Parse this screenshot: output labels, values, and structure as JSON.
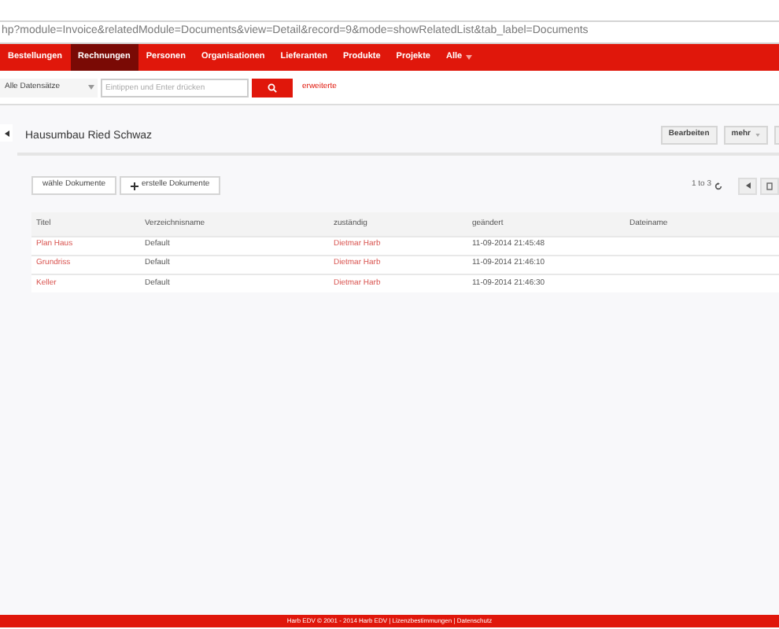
{
  "address_bar": {
    "url": "hp?module=Invoice&relatedModule=Documents&view=Detail&record=9&mode=showRelatedList&tab_label=Documents"
  },
  "nav": [
    {
      "label": "Bestellungen",
      "selected": false
    },
    {
      "label": "Rechnungen",
      "selected": true
    },
    {
      "label": "Personen",
      "selected": false
    },
    {
      "label": "Organisationen",
      "selected": false
    },
    {
      "label": "Lieferanten",
      "selected": false
    },
    {
      "label": "Produkte",
      "selected": false
    },
    {
      "label": "Projekte",
      "selected": false
    },
    {
      "label": "Alle",
      "selected": false,
      "dropdown": true
    }
  ],
  "search": {
    "filter": "Alle Datensätze",
    "placeholder": "Eintippen und Enter drücken",
    "advanced_link": "erweiterte"
  },
  "record": {
    "title": "Hausumbau Ried Schwaz",
    "actions": [
      "Bearbeiten",
      "mehr"
    ]
  },
  "related": {
    "buttons": [
      {
        "label": "wähle Dokumente",
        "kind": "plain"
      },
      {
        "label": "erstelle Dokumente",
        "kind": "add"
      }
    ],
    "pagination": "1 to 3",
    "columns": [
      "Titel",
      "Verzeichnisname",
      "zuständig",
      "geändert",
      "Dateiname"
    ],
    "rows": [
      [
        "Plan Haus",
        "Default",
        "Dietmar Harb",
        "11-09-2014 21:45:48",
        ""
      ],
      [
        "Grundriss",
        "Default",
        "Dietmar Harb",
        "11-09-2014 21:46:10",
        ""
      ],
      [
        "Keller",
        "Default",
        "Dietmar Harb",
        "11-09-2014 21:46:30",
        ""
      ]
    ]
  },
  "footer": {
    "text": "Harb EDV  © 2001 - 2014  Harb EDV | Lizenzbestimmungen | Datenschutz"
  }
}
